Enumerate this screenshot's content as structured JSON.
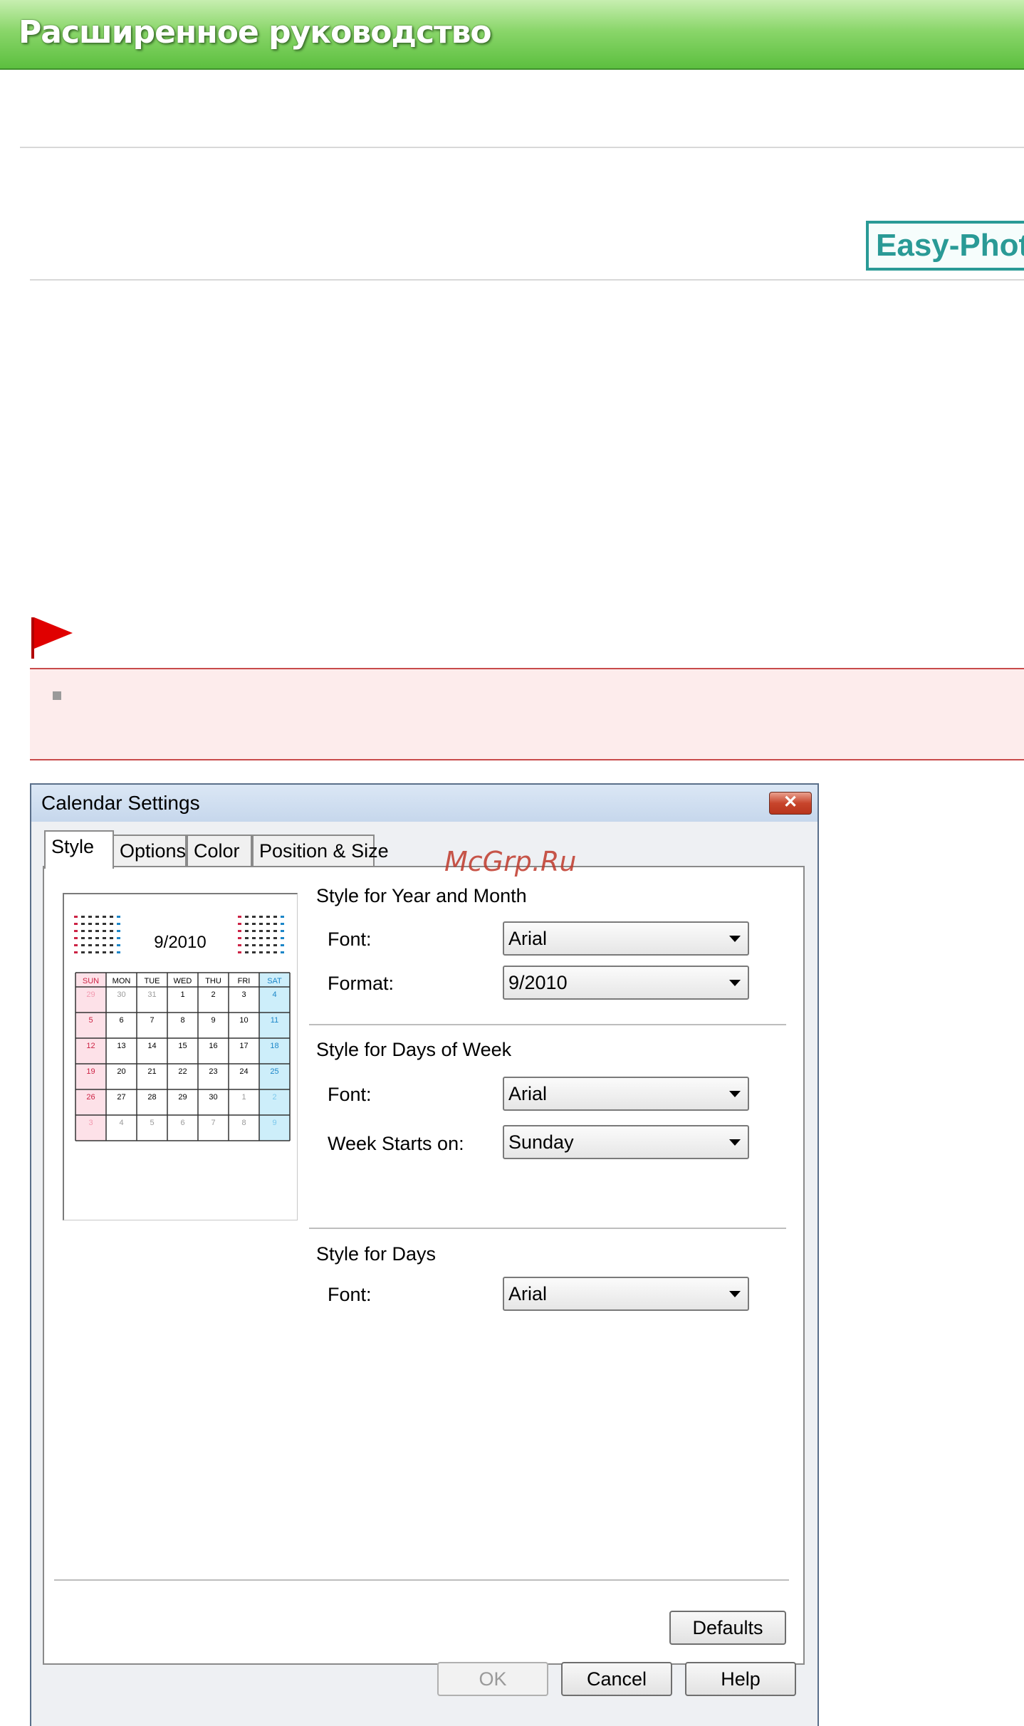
{
  "banner": {
    "title": "Расширенное руководство"
  },
  "logo": {
    "text": "Easy-PhotoPrint EX"
  },
  "dialog": {
    "title": "Calendar Settings",
    "close_symbol": "✕",
    "tabs": [
      {
        "label": "Style",
        "active": true
      },
      {
        "label": "Options",
        "active": false
      },
      {
        "label": "Color",
        "active": false
      },
      {
        "label": "Position & Size",
        "active": false
      }
    ],
    "preview": {
      "month_label": "9/2010",
      "weekdays": [
        "SUN",
        "MON",
        "TUE",
        "WED",
        "THU",
        "FRI",
        "SAT"
      ],
      "weeks": [
        [
          "29",
          "30",
          "31",
          "1",
          "2",
          "3",
          "4"
        ],
        [
          "5",
          "6",
          "7",
          "8",
          "9",
          "10",
          "11"
        ],
        [
          "12",
          "13",
          "14",
          "15",
          "16",
          "17",
          "18"
        ],
        [
          "19",
          "20",
          "21",
          "22",
          "23",
          "24",
          "25"
        ],
        [
          "26",
          "27",
          "28",
          "29",
          "30",
          "1",
          "2"
        ],
        [
          "3",
          "4",
          "5",
          "6",
          "7",
          "8",
          "9"
        ]
      ],
      "colors": {
        "sunday": "#cc2244",
        "saturday": "#1c86c8",
        "sunday_bg": "#fde1e8",
        "saturday_bg": "#cdeefa"
      }
    },
    "year_month": {
      "title": "Style for Year and Month",
      "font_label": "Font:",
      "font_value": "Arial",
      "format_label": "Format:",
      "format_value": "9/2010"
    },
    "days_of_week": {
      "title": "Style for Days of Week",
      "font_label": "Font:",
      "font_value": "Arial",
      "week_starts_label": "Week Starts on:",
      "week_starts_value": "Sunday"
    },
    "days": {
      "title": "Style for Days",
      "font_label": "Font:",
      "font_value": "Arial"
    },
    "buttons": {
      "defaults": "Defaults",
      "ok": "OK",
      "cancel": "Cancel",
      "help": "Help"
    }
  },
  "watermark": "McGrp.Ru"
}
